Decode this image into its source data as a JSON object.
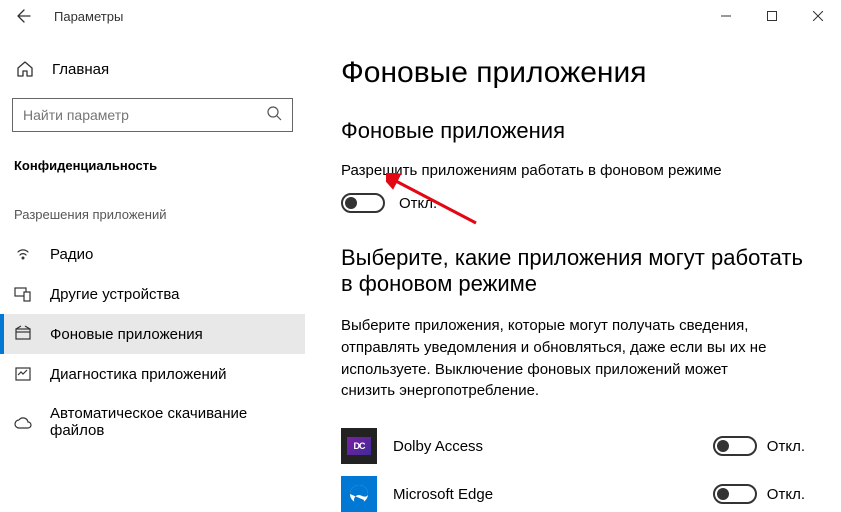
{
  "window": {
    "title": "Параметры"
  },
  "sidebar": {
    "home": "Главная",
    "search_placeholder": "Найти параметр",
    "section": "Конфиденциальность",
    "group_heading": "Разрешения приложений",
    "items": [
      {
        "label": "Радио"
      },
      {
        "label": "Другие устройства"
      },
      {
        "label": "Фоновые приложения"
      },
      {
        "label": "Диагностика приложений"
      },
      {
        "label": "Автоматическое скачивание файлов"
      }
    ]
  },
  "content": {
    "h1": "Фоновые приложения",
    "h2a": "Фоновые приложения",
    "allow_desc": "Разрешить приложениям работать в фоновом режиме",
    "allow_state": "Откл.",
    "h2b": "Выберите, какие приложения могут работать в фоновом режиме",
    "choose_para": "Выберите приложения, которые могут получать сведения, отправлять уведомления и обновляться, даже если вы их не используете. Выключение фоновых приложений может снизить энергопотребление.",
    "apps": [
      {
        "name": "Dolby Access",
        "state": "Откл."
      },
      {
        "name": "Microsoft Edge",
        "state": "Откл."
      }
    ]
  }
}
